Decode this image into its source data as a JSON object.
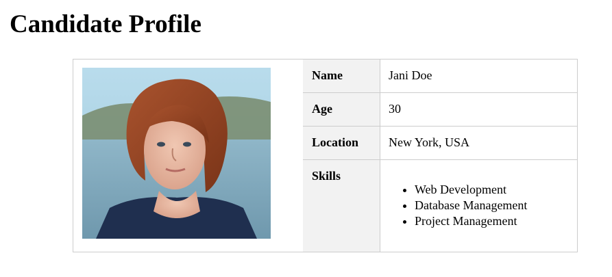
{
  "page": {
    "title": "Candidate Profile"
  },
  "profile": {
    "photo_icon": "portrait-photo",
    "fields": [
      {
        "label": "Name",
        "value": "Jani Doe"
      },
      {
        "label": "Age",
        "value": "30"
      },
      {
        "label": "Location",
        "value": "New York, USA"
      }
    ],
    "skills": {
      "label": "Skills",
      "items": [
        "Web Development",
        "Database Management",
        "Project Management"
      ]
    }
  },
  "colors": {
    "border": "#cccccc",
    "label_bg": "#f2f2f2",
    "text": "#000000"
  }
}
